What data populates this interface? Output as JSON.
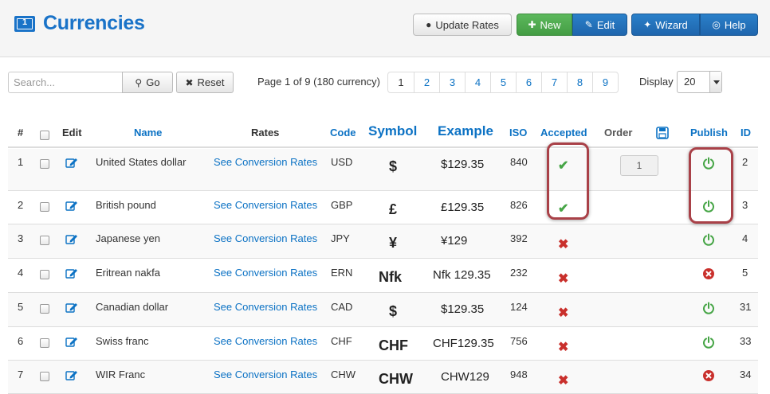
{
  "header": {
    "title": "Currencies",
    "buttons": {
      "update": "Update Rates",
      "new": "New",
      "edit": "Edit",
      "wizard": "Wizard",
      "help": "Help"
    }
  },
  "toolbar": {
    "search_placeholder": "Search...",
    "go": "Go",
    "reset": "Reset",
    "page_info": "Page 1 of 9 (180 currency)",
    "pages": [
      "1",
      "2",
      "3",
      "4",
      "5",
      "6",
      "7",
      "8",
      "9"
    ],
    "display_label": "Display",
    "display_value": "20"
  },
  "table": {
    "headers": {
      "num": "#",
      "edit": "Edit",
      "name": "Name",
      "rates": "Rates",
      "code": "Code",
      "symbol": "Symbol",
      "example": "Example",
      "iso": "ISO",
      "accepted": "Accepted",
      "order": "Order",
      "publish": "Publish",
      "id": "ID"
    },
    "rows": [
      {
        "num": "1",
        "name": "United States dollar",
        "rates": "See Conversion Rates",
        "code": "USD",
        "symbol": "$",
        "example": "$129.35",
        "iso": "840",
        "accepted": "✔",
        "order": "1",
        "published": true,
        "id": "2"
      },
      {
        "num": "2",
        "name": "British pound",
        "rates": "See Conversion Rates",
        "code": "GBP",
        "symbol": "£",
        "example": "£129.35",
        "iso": "826",
        "accepted": "✔",
        "order": "",
        "published": true,
        "id": "3"
      },
      {
        "num": "3",
        "name": "Japanese yen",
        "rates": "See Conversion Rates",
        "code": "JPY",
        "symbol": "¥",
        "example": "¥129",
        "iso": "392",
        "accepted": "✖",
        "order": "",
        "published": true,
        "id": "4"
      },
      {
        "num": "4",
        "name": "Eritrean nakfa",
        "rates": "See Conversion Rates",
        "code": "ERN",
        "symbol": "Nfk",
        "example": "Nfk 129.35",
        "iso": "232",
        "accepted": "✖",
        "order": "",
        "published": false,
        "id": "5"
      },
      {
        "num": "5",
        "name": "Canadian dollar",
        "rates": "See Conversion Rates",
        "code": "CAD",
        "symbol": "$",
        "example": "$129.35",
        "iso": "124",
        "accepted": "✖",
        "order": "",
        "published": true,
        "id": "31"
      },
      {
        "num": "6",
        "name": "Swiss franc",
        "rates": "See Conversion Rates",
        "code": "CHF",
        "symbol": "CHF",
        "example": "CHF129.35",
        "iso": "756",
        "accepted": "✖",
        "order": "",
        "published": true,
        "id": "33"
      },
      {
        "num": "7",
        "name": "WIR Franc",
        "rates": "See Conversion Rates",
        "code": "CHW",
        "symbol": "CHW",
        "example": "CHW129",
        "iso": "948",
        "accepted": "✖",
        "order": "",
        "published": false,
        "id": "34"
      }
    ]
  },
  "colors": {
    "brand": "#1a73c8",
    "accept": "#46a546",
    "reject": "#c9302c",
    "highlight": "#a94148"
  }
}
